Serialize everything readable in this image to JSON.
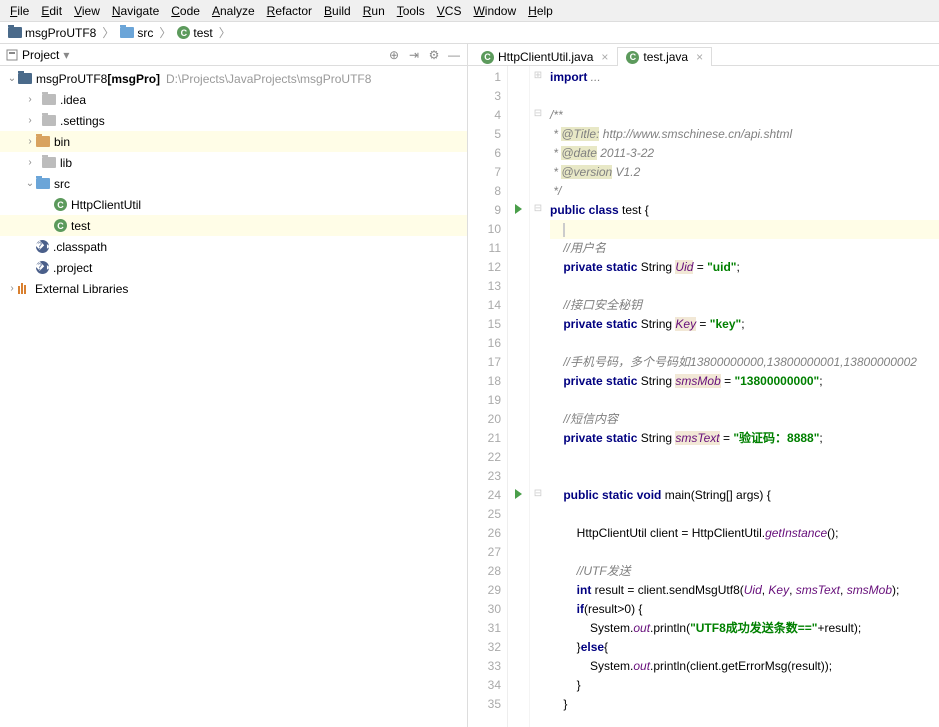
{
  "menu": [
    "File",
    "Edit",
    "View",
    "Navigate",
    "Code",
    "Analyze",
    "Refactor",
    "Build",
    "Run",
    "Tools",
    "VCS",
    "Window",
    "Help"
  ],
  "breadcrumb": [
    {
      "icon": "folder",
      "label": "msgProUTF8"
    },
    {
      "icon": "folder-blue",
      "label": "src"
    },
    {
      "icon": "class",
      "label": "test"
    }
  ],
  "sidebar": {
    "title": "Project",
    "tools": [
      "target",
      "collapse",
      "gear",
      "hide"
    ],
    "tree": [
      {
        "d": 0,
        "tw": "v",
        "icon": "folder",
        "label": "msgProUTF8",
        "bold": "[msgPro]",
        "gray": "D:\\Projects\\JavaProjects\\msgProUTF8"
      },
      {
        "d": 1,
        "tw": ">",
        "icon": "folder-gray",
        "label": ".idea"
      },
      {
        "d": 1,
        "tw": ">",
        "icon": "folder-gray",
        "label": ".settings"
      },
      {
        "d": 1,
        "tw": ">",
        "icon": "folder-orange",
        "label": "bin",
        "sel": true
      },
      {
        "d": 1,
        "tw": ">",
        "icon": "folder-gray",
        "label": "lib"
      },
      {
        "d": 1,
        "tw": "v",
        "icon": "folder-blue",
        "label": "src"
      },
      {
        "d": 2,
        "tw": "",
        "icon": "class",
        "label": "HttpClientUtil"
      },
      {
        "d": 2,
        "tw": "",
        "icon": "class",
        "label": "test",
        "sel": true
      },
      {
        "d": 1,
        "tw": "",
        "icon": "eclipse",
        "label": ".classpath"
      },
      {
        "d": 1,
        "tw": "",
        "icon": "eclipse",
        "label": ".project"
      },
      {
        "d": 0,
        "tw": ">",
        "icon": "lib",
        "label": "External Libraries"
      }
    ]
  },
  "tabs": [
    {
      "label": "HttpClientUtil.java",
      "active": false
    },
    {
      "label": "test.java",
      "active": true
    }
  ],
  "code": {
    "lines": [
      {
        "n": 1,
        "fold": "+",
        "segs": [
          {
            "t": "import ",
            "c": "kw"
          },
          {
            "t": "...",
            "c": "cm"
          }
        ]
      },
      {
        "n": 3,
        "segs": []
      },
      {
        "n": 4,
        "fold": "-",
        "segs": [
          {
            "t": "/**",
            "c": "cm"
          }
        ]
      },
      {
        "n": 5,
        "segs": [
          {
            "t": " * ",
            "c": "cm"
          },
          {
            "t": "@Title:",
            "c": "ann"
          },
          {
            "t": " http://www.smschinese.cn/api.shtml",
            "c": "cm"
          }
        ]
      },
      {
        "n": 6,
        "segs": [
          {
            "t": " * ",
            "c": "cm"
          },
          {
            "t": "@date",
            "c": "ann"
          },
          {
            "t": " 2011-3-22",
            "c": "cm"
          }
        ]
      },
      {
        "n": 7,
        "segs": [
          {
            "t": " * ",
            "c": "cm"
          },
          {
            "t": "@version",
            "c": "ann"
          },
          {
            "t": " V1.2",
            "c": "cm"
          }
        ]
      },
      {
        "n": 8,
        "segs": [
          {
            "t": " */",
            "c": "cm"
          }
        ]
      },
      {
        "n": 9,
        "run": true,
        "fold": "-",
        "segs": [
          {
            "t": "public class ",
            "c": "kw"
          },
          {
            "t": "test {",
            "c": ""
          }
        ]
      },
      {
        "n": 10,
        "hl": true,
        "segs": [
          {
            "t": "    ",
            "c": ""
          },
          {
            "cursor": true
          }
        ]
      },
      {
        "n": 11,
        "segs": [
          {
            "t": "    ",
            "c": ""
          },
          {
            "t": "//用户名",
            "c": "cm"
          }
        ]
      },
      {
        "n": 12,
        "segs": [
          {
            "t": "    ",
            "c": ""
          },
          {
            "t": "private static ",
            "c": "kw"
          },
          {
            "t": "String ",
            "c": ""
          },
          {
            "t": "Uid",
            "c": "fld"
          },
          {
            "t": " = ",
            "c": ""
          },
          {
            "t": "\"uid\"",
            "c": "str"
          },
          {
            "t": ";",
            "c": ""
          }
        ]
      },
      {
        "n": 13,
        "segs": []
      },
      {
        "n": 14,
        "segs": [
          {
            "t": "    ",
            "c": ""
          },
          {
            "t": "//接口安全秘钥",
            "c": "cm"
          }
        ]
      },
      {
        "n": 15,
        "segs": [
          {
            "t": "    ",
            "c": ""
          },
          {
            "t": "private static ",
            "c": "kw"
          },
          {
            "t": "String ",
            "c": ""
          },
          {
            "t": "Key",
            "c": "fld"
          },
          {
            "t": " = ",
            "c": ""
          },
          {
            "t": "\"key\"",
            "c": "str"
          },
          {
            "t": ";",
            "c": ""
          }
        ]
      },
      {
        "n": 16,
        "segs": []
      },
      {
        "n": 17,
        "segs": [
          {
            "t": "    ",
            "c": ""
          },
          {
            "t": "//手机号码，多个号码如",
            "c": "cm"
          },
          {
            "t": "13800000000,13800000001,13800000002",
            "c": "cm"
          }
        ]
      },
      {
        "n": 18,
        "segs": [
          {
            "t": "    ",
            "c": ""
          },
          {
            "t": "private static ",
            "c": "kw"
          },
          {
            "t": "String ",
            "c": ""
          },
          {
            "t": "smsMob",
            "c": "fld"
          },
          {
            "t": " = ",
            "c": ""
          },
          {
            "t": "\"13800000000\"",
            "c": "str"
          },
          {
            "t": ";",
            "c": ""
          }
        ]
      },
      {
        "n": 19,
        "segs": []
      },
      {
        "n": 20,
        "segs": [
          {
            "t": "    ",
            "c": ""
          },
          {
            "t": "//短信内容",
            "c": "cm"
          }
        ]
      },
      {
        "n": 21,
        "segs": [
          {
            "t": "    ",
            "c": ""
          },
          {
            "t": "private static ",
            "c": "kw"
          },
          {
            "t": "String ",
            "c": ""
          },
          {
            "t": "smsText",
            "c": "fld"
          },
          {
            "t": " = ",
            "c": ""
          },
          {
            "t": "\"验证码：8888\"",
            "c": "str"
          },
          {
            "t": ";",
            "c": ""
          }
        ]
      },
      {
        "n": 22,
        "segs": []
      },
      {
        "n": 23,
        "segs": []
      },
      {
        "n": 24,
        "run": true,
        "fold": "-",
        "segs": [
          {
            "t": "    ",
            "c": ""
          },
          {
            "t": "public static void ",
            "c": "kw"
          },
          {
            "t": "main(String[] args) {",
            "c": ""
          }
        ]
      },
      {
        "n": 25,
        "segs": []
      },
      {
        "n": 26,
        "segs": [
          {
            "t": "        HttpClientUtil client = HttpClientUtil.",
            "c": ""
          },
          {
            "t": "getInstance",
            "c": "fld2"
          },
          {
            "t": "();",
            "c": ""
          }
        ]
      },
      {
        "n": 27,
        "segs": []
      },
      {
        "n": 28,
        "segs": [
          {
            "t": "        ",
            "c": ""
          },
          {
            "t": "//UTF发送",
            "c": "cm"
          }
        ]
      },
      {
        "n": 29,
        "segs": [
          {
            "t": "        ",
            "c": ""
          },
          {
            "t": "int ",
            "c": "kw"
          },
          {
            "t": "result = client.sendMsgUtf8(",
            "c": ""
          },
          {
            "t": "Uid",
            "c": "fld2"
          },
          {
            "t": ", ",
            "c": ""
          },
          {
            "t": "Key",
            "c": "fld2"
          },
          {
            "t": ", ",
            "c": ""
          },
          {
            "t": "smsText",
            "c": "fld2"
          },
          {
            "t": ", ",
            "c": ""
          },
          {
            "t": "smsMob",
            "c": "fld2"
          },
          {
            "t": ");",
            "c": ""
          }
        ]
      },
      {
        "n": 30,
        "segs": [
          {
            "t": "        ",
            "c": ""
          },
          {
            "t": "if",
            "c": "kw"
          },
          {
            "t": "(result>",
            "c": ""
          },
          {
            "t": "0",
            "c": ""
          },
          {
            "t": ") {",
            "c": ""
          }
        ]
      },
      {
        "n": 31,
        "segs": [
          {
            "t": "            System.",
            "c": ""
          },
          {
            "t": "out",
            "c": "fld2"
          },
          {
            "t": ".println(",
            "c": ""
          },
          {
            "t": "\"UTF8成功发送条数==\"",
            "c": "str"
          },
          {
            "t": "+result);",
            "c": ""
          }
        ]
      },
      {
        "n": 32,
        "segs": [
          {
            "t": "        }",
            "c": ""
          },
          {
            "t": "else",
            "c": "kw"
          },
          {
            "t": "{",
            "c": ""
          }
        ]
      },
      {
        "n": 33,
        "segs": [
          {
            "t": "            System.",
            "c": ""
          },
          {
            "t": "out",
            "c": "fld2"
          },
          {
            "t": ".println(client.getErrorMsg(result));",
            "c": ""
          }
        ]
      },
      {
        "n": 34,
        "segs": [
          {
            "t": "        }",
            "c": ""
          }
        ]
      },
      {
        "n": 35,
        "segs": [
          {
            "t": "    }",
            "c": ""
          }
        ]
      }
    ]
  }
}
